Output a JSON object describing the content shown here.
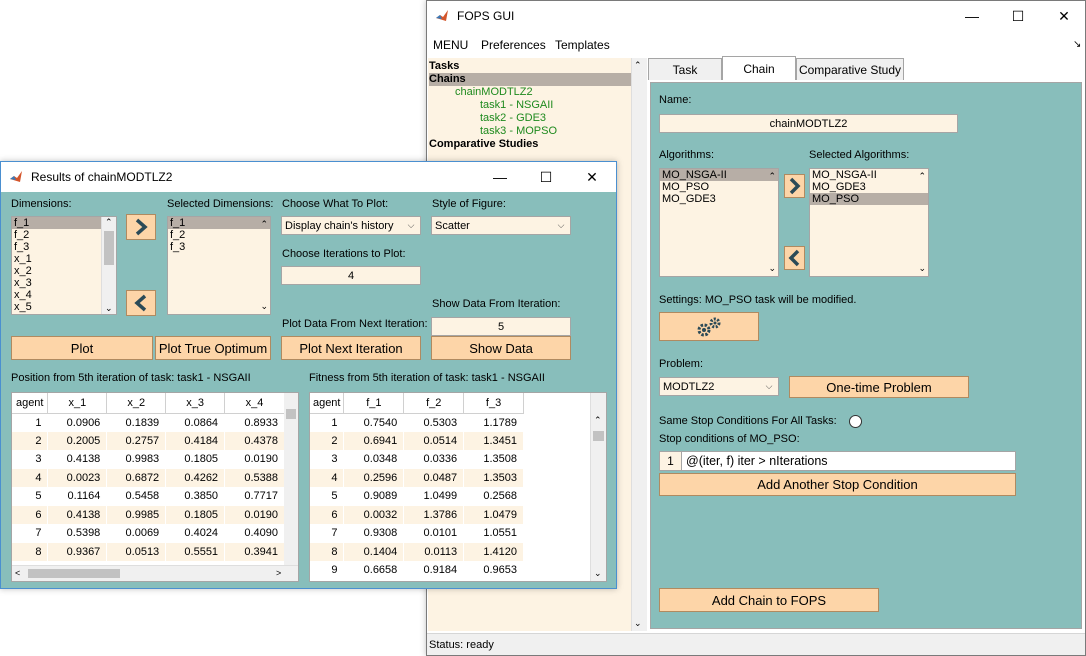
{
  "fops": {
    "title": "FOPS GUI",
    "menu": [
      "MENU",
      "Preferences",
      "Templates"
    ],
    "tree": {
      "tasks": "Tasks",
      "chains": "Chains",
      "chain_name": "chainMODTLZ2",
      "chain_tasks": [
        "task1 - NSGAII",
        "task2 - GDE3",
        "task3 - MOPSO"
      ],
      "comparative": "Comparative Studies"
    },
    "tabs": [
      "Task",
      "Chain",
      "Comparative Study"
    ],
    "name_label": "Name:",
    "name_value": "chainMODTLZ2",
    "algorithms_label": "Algorithms:",
    "algorithms": [
      "MO_NSGA-II",
      "MO_PSO",
      "MO_GDE3"
    ],
    "selected_algorithms_label": "Selected Algorithms:",
    "selected_algorithms": [
      "MO_NSGA-II",
      "MO_GDE3",
      "MO_PSO"
    ],
    "settings_label": "Settings: MO_PSO task will be modified.",
    "problem_label": "Problem:",
    "problem_value": "MODTLZ2",
    "one_time_button": "One-time Problem",
    "same_stop_label": "Same Stop Conditions For All Tasks:",
    "stop_conditions_label": "Stop conditions of MO_PSO:",
    "stop_index": "1",
    "stop_condition": "@(iter, f) iter > nIterations",
    "add_stop_button": "Add Another Stop Condition",
    "add_chain_button": "Add Chain to FOPS",
    "status": "Status: ready"
  },
  "results": {
    "title": "Results of chainMODTLZ2",
    "dimensions_label": "Dimensions:",
    "dimensions": [
      "f_1",
      "f_2",
      "f_3",
      "x_1",
      "x_2",
      "x_3",
      "x_4",
      "x_5"
    ],
    "selected_dimensions_label": "Selected Dimensions:",
    "selected_dimensions": [
      "f_1",
      "f_2",
      "f_3"
    ],
    "choose_plot_label": "Choose What To Plot:",
    "choose_plot_value": "Display chain's history",
    "style_label": "Style of Figure:",
    "style_value": "Scatter",
    "iterations_label": "Choose Iterations to Plot:",
    "iterations_value": "4",
    "show_from_label": "Show Data From Iteration:",
    "show_from_value": "5",
    "next_iter_label": "Plot Data From Next Iteration:",
    "plot_button": "Plot",
    "plot_true_button": "Plot True Optimum",
    "plot_next_button": "Plot Next Iteration",
    "show_data_button": "Show Data",
    "position_title": "Position from 5th iteration of task: task1 - NSGAII",
    "fitness_title": "Fitness from 5th iteration of task: task1 - NSGAII",
    "position_columns": [
      "agent",
      "x_1",
      "x_2",
      "x_3",
      "x_4"
    ],
    "position_rows": [
      [
        "1",
        "0.0906",
        "0.1839",
        "0.0864",
        "0.8933"
      ],
      [
        "2",
        "0.2005",
        "0.2757",
        "0.4184",
        "0.4378"
      ],
      [
        "3",
        "0.4138",
        "0.9983",
        "0.1805",
        "0.0190"
      ],
      [
        "4",
        "0.0023",
        "0.6872",
        "0.4262",
        "0.5388"
      ],
      [
        "5",
        "0.1164",
        "0.5458",
        "0.3850",
        "0.7717"
      ],
      [
        "6",
        "0.4138",
        "0.9985",
        "0.1805",
        "0.0190"
      ],
      [
        "7",
        "0.5398",
        "0.0069",
        "0.4024",
        "0.4090"
      ],
      [
        "8",
        "0.9367",
        "0.0513",
        "0.5551",
        "0.3941"
      ]
    ],
    "fitness_columns": [
      "agent",
      "f_1",
      "f_2",
      "f_3"
    ],
    "fitness_rows": [
      [
        "1",
        "0.7540",
        "0.5303",
        "1.1789"
      ],
      [
        "2",
        "0.6941",
        "0.0514",
        "1.3451"
      ],
      [
        "3",
        "0.0348",
        "0.0336",
        "1.3508"
      ],
      [
        "4",
        "0.2596",
        "0.0487",
        "1.3503"
      ],
      [
        "5",
        "0.9089",
        "1.0499",
        "0.2568"
      ],
      [
        "6",
        "0.0032",
        "1.3786",
        "1.0479"
      ],
      [
        "7",
        "0.9308",
        "0.0101",
        "1.0551"
      ],
      [
        "8",
        "0.1404",
        "0.0113",
        "1.4120"
      ],
      [
        "9",
        "0.6658",
        "0.9184",
        "0.9653"
      ]
    ]
  }
}
